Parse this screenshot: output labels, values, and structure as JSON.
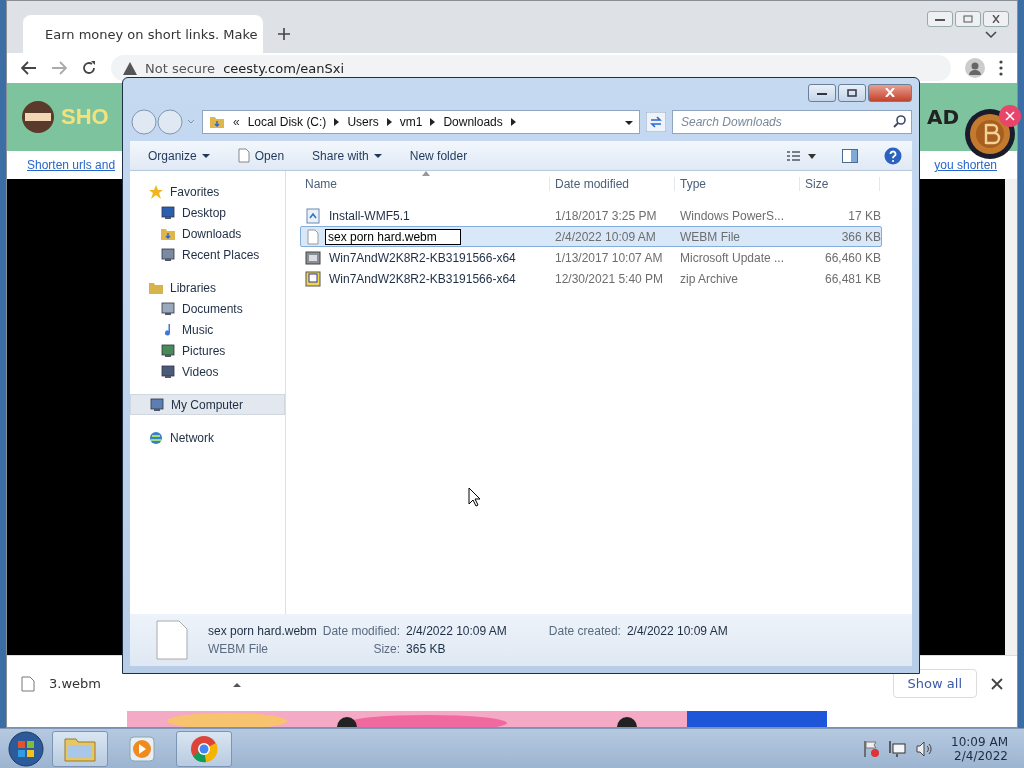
{
  "browser": {
    "tab_title": "Earn money on short links. Make",
    "security_label": "Not secure",
    "url": "ceesty.com/eanSxi",
    "page": {
      "logo_text": "SHO",
      "ad_text": "AD",
      "link_left": "Shorten urls and",
      "link_right": "you shorten"
    },
    "downloads": [
      {
        "name": "3.webm"
      }
    ],
    "show_all": "Show all"
  },
  "explorer": {
    "breadcrumb": [
      "Local Disk (C:)",
      "Users",
      "vm1",
      "Downloads"
    ],
    "search_placeholder": "Search Downloads",
    "toolbar": [
      {
        "label": "Organize",
        "kind": "menu"
      },
      {
        "label": "Open",
        "kind": "open"
      },
      {
        "label": "Share with",
        "kind": "menu"
      },
      {
        "label": "New folder",
        "kind": "button"
      }
    ],
    "overflow_mark": "«",
    "nav": [
      {
        "label": "Favorites",
        "selected": false,
        "children": [
          {
            "label": "Desktop",
            "selected": false
          },
          {
            "label": "Downloads",
            "selected": false
          },
          {
            "label": "Recent Places",
            "selected": false
          }
        ]
      },
      {
        "label": "Libraries",
        "selected": false,
        "children": [
          {
            "label": "Documents",
            "selected": false
          },
          {
            "label": "Music",
            "selected": false
          },
          {
            "label": "Pictures",
            "selected": false
          },
          {
            "label": "Videos",
            "selected": false
          }
        ]
      },
      {
        "label": "My Computer",
        "selected": true
      },
      {
        "label": "Network",
        "selected": false
      }
    ],
    "columns": [
      "Name",
      "Date modified",
      "Type",
      "Size"
    ],
    "files": [
      {
        "name": "Install-WMF5.1",
        "date": "1/18/2017 3:25 PM",
        "type": "Windows PowerS...",
        "size": "17 KB",
        "selected": false,
        "renaming": false
      },
      {
        "name": "sex porn hard.webm",
        "date": "2/4/2022 10:09 AM",
        "type": "WEBM File",
        "size": "366 KB",
        "selected": true,
        "renaming": true
      },
      {
        "name": "Win7AndW2K8R2-KB3191566-x64",
        "date": "1/13/2017 10:07 AM",
        "type": "Microsoft Update ...",
        "size": "66,460 KB",
        "selected": false,
        "renaming": false
      },
      {
        "name": "Win7AndW2K8R2-KB3191566-x64",
        "date": "12/30/2021 5:40 PM",
        "type": "zip Archive",
        "size": "66,481 KB",
        "selected": false,
        "renaming": false
      }
    ],
    "details": {
      "name": "sex porn hard.webm",
      "type": "WEBM File",
      "modified_label": "Date modified:",
      "modified": "2/4/2022 10:09 AM",
      "size_label": "Size:",
      "size": "365 KB",
      "created_label": "Date created:",
      "created": "2/4/2022 10:09 AM"
    }
  },
  "taskbar": {
    "apps": [
      {
        "kind": "explorer",
        "active": true
      },
      {
        "kind": "media",
        "active": false
      },
      {
        "kind": "chrome",
        "active": true
      }
    ],
    "time": "10:09 AM",
    "date": "2/4/2022"
  }
}
